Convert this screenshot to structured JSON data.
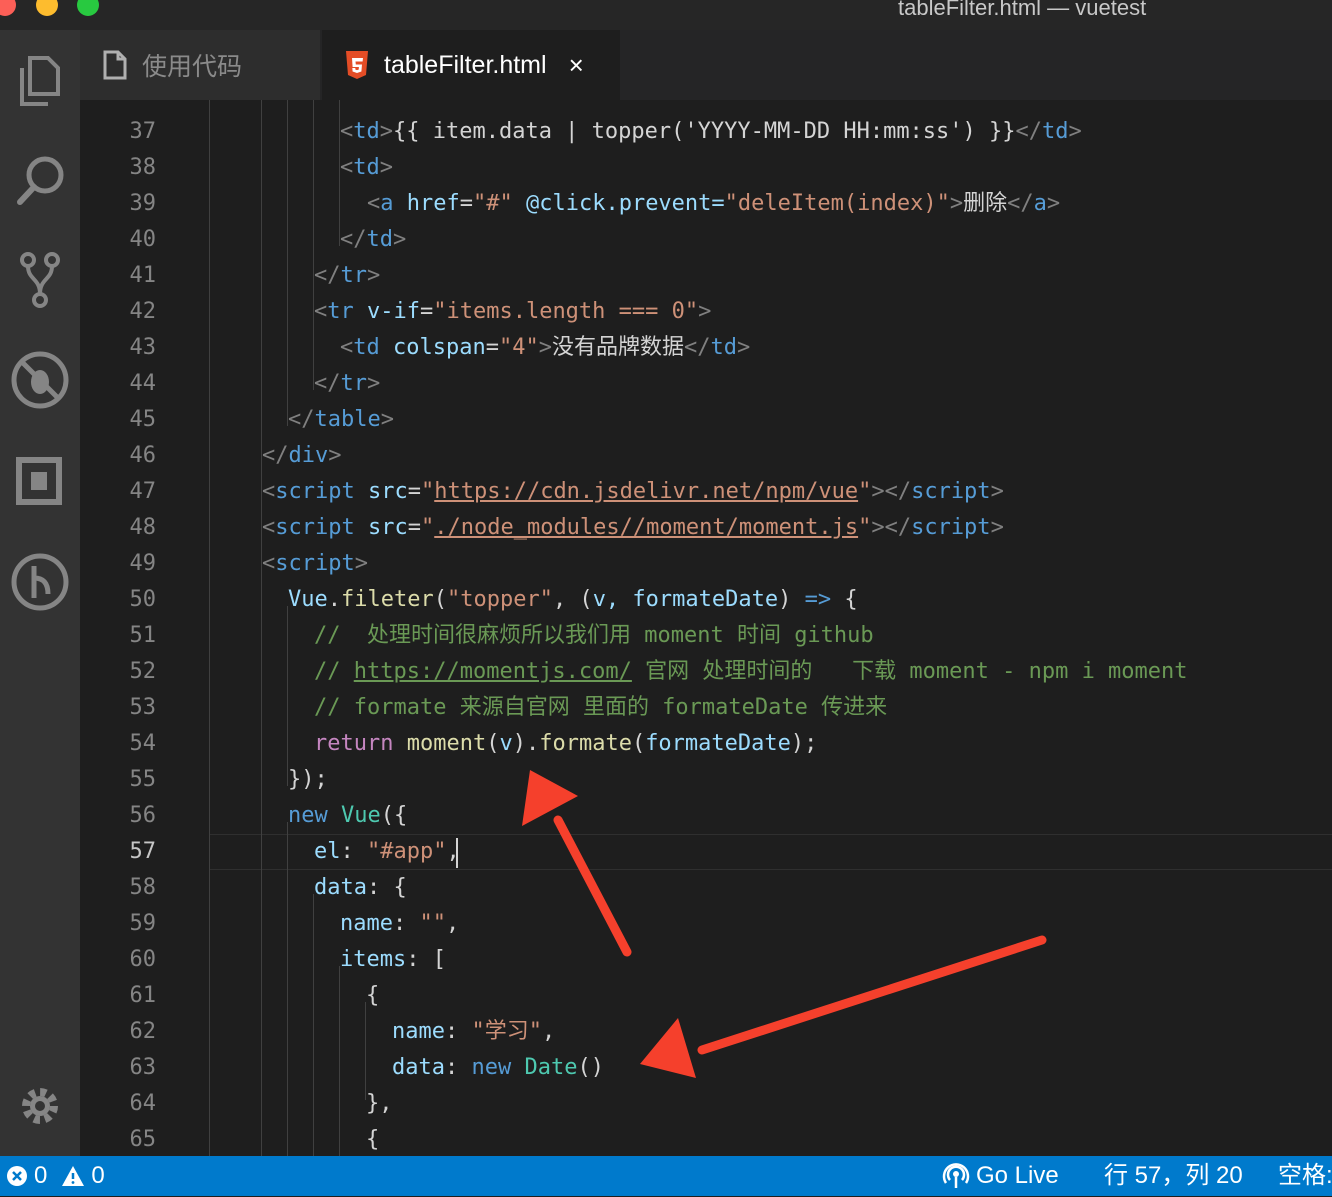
{
  "window": {
    "title": "tableFilter.html — vuetest"
  },
  "tabs": [
    {
      "label": "使用代码",
      "icon": "file-icon",
      "active": false
    },
    {
      "label": "tableFilter.html",
      "icon": "html5-icon",
      "close": "×",
      "active": true
    }
  ],
  "activity_bar": {
    "icons": [
      "explorer-icon",
      "search-icon",
      "source-control-icon",
      "debug-icon",
      "extensions-icon",
      "git-history-icon",
      "settings-gear-icon"
    ]
  },
  "editor": {
    "current_line": "57",
    "lines": [
      {
        "n": "37"
      },
      {
        "n": "38"
      },
      {
        "n": "39"
      },
      {
        "n": "40"
      },
      {
        "n": "41"
      },
      {
        "n": "42"
      },
      {
        "n": "43"
      },
      {
        "n": "44"
      },
      {
        "n": "45"
      },
      {
        "n": "46"
      },
      {
        "n": "47"
      },
      {
        "n": "48"
      },
      {
        "n": "49"
      },
      {
        "n": "50"
      },
      {
        "n": "51"
      },
      {
        "n": "52"
      },
      {
        "n": "53"
      },
      {
        "n": "54"
      },
      {
        "n": "55"
      },
      {
        "n": "56"
      },
      {
        "n": "57"
      },
      {
        "n": "58"
      },
      {
        "n": "59"
      },
      {
        "n": "60"
      },
      {
        "n": "61"
      },
      {
        "n": "62"
      },
      {
        "n": "63"
      },
      {
        "n": "64"
      },
      {
        "n": "65"
      }
    ],
    "code": {
      "l37_expr": "{{ item.data | topper('YYYY-MM-DD HH:mm:ss') }}",
      "l39_value": "\"#\"",
      "l39_event": "@click.prevent=",
      "l39_handler": "\"deleItem(index)\"",
      "l39_text": "删除",
      "l42_value": "\"items.length === 0\"",
      "l43_value": "\"4\"",
      "l43_text": "没有品牌数据",
      "l47_src": "https://cdn.jsdelivr.net/npm/vue",
      "l48_src": "./node_modules//moment/moment.js",
      "l50_name": "\"topper\"",
      "l50_params": "v, formateDate",
      "l51_comment": "//  处理时间很麻烦所以我们用 moment 时间 github",
      "l52_url": "https://momentjs.com/",
      "l52_rest": " 官网 处理时间的   下载 moment - npm i moment",
      "l53_comment": "// formate 来源自官网 里面的 formateDate 传进来",
      "l57_value": "\"#app\"",
      "l59_value": "\"\"",
      "l62_value": "\"学习\""
    }
  },
  "annotations": {
    "color": "#f5402c"
  },
  "status_bar": {
    "errors": "0",
    "warnings": "0",
    "go_live": "Go Live",
    "position": "行 57，列 20",
    "spaces": "空格:"
  }
}
